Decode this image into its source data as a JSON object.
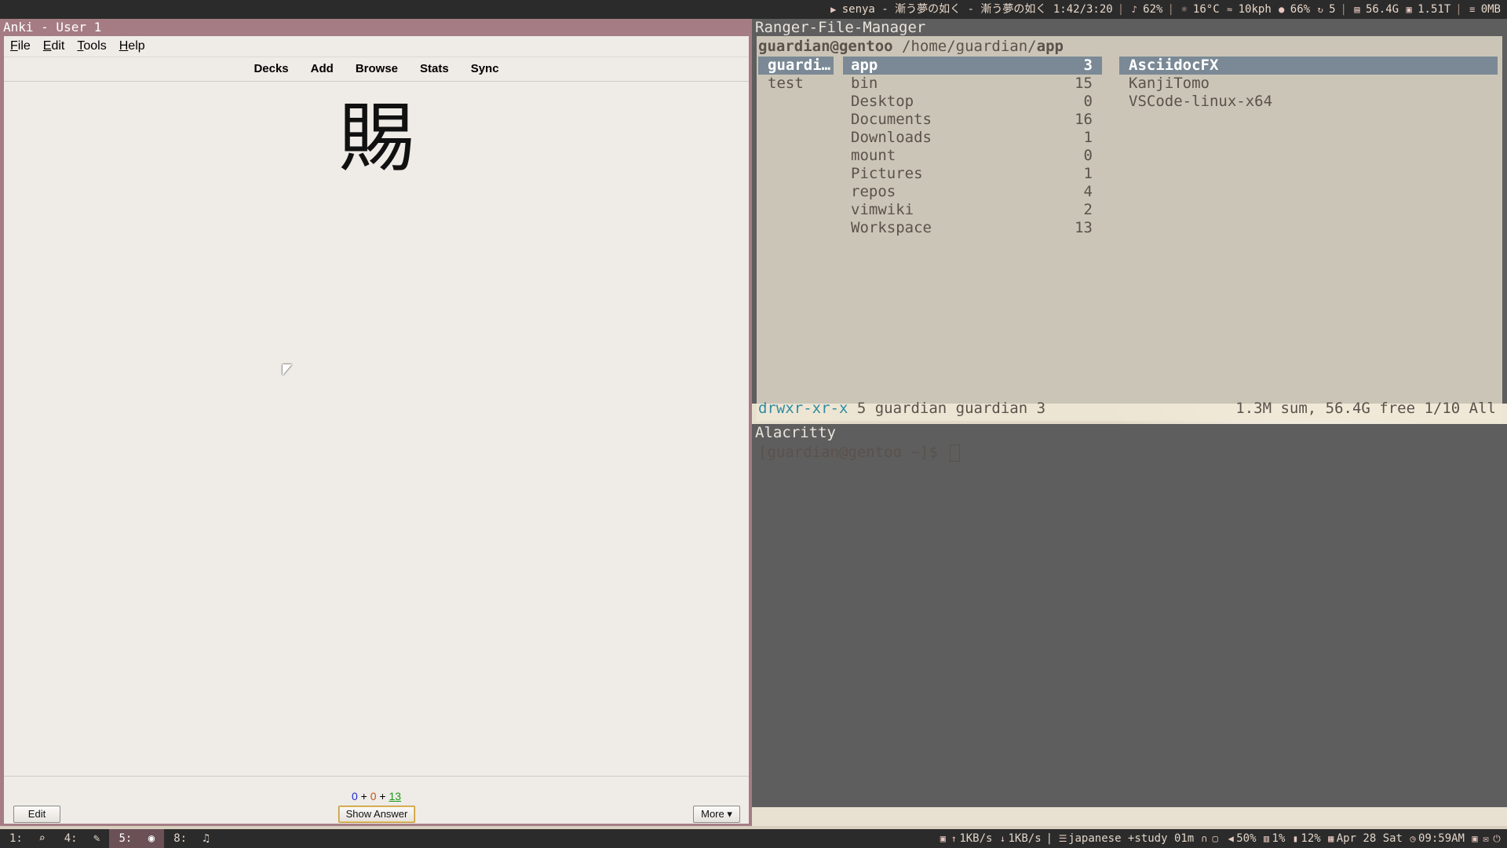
{
  "topbar": {
    "now_playing": "senya - 漸う夢の如く - 漸う夢の如く 1:42/3:20",
    "volume": "62%",
    "temp": "16°C",
    "wind": "10kph",
    "humidity": "66%",
    "updates": "5",
    "disk1": "56.4G",
    "disk2": "1.51T",
    "mem": "0MB"
  },
  "anki": {
    "window_title": "Anki - User 1",
    "menu": [
      "File",
      "Edit",
      "Tools",
      "Help"
    ],
    "toolbar": [
      "Decks",
      "Add",
      "Browse",
      "Stats",
      "Sync"
    ],
    "card_front": "賜",
    "counts": {
      "new": "0",
      "learn": "0",
      "review": "13",
      "plus": "+"
    },
    "buttons": {
      "edit": "Edit",
      "show_answer": "Show Answer",
      "more": "More ▾"
    }
  },
  "ranger": {
    "window_title": "Ranger-File-Manager",
    "user_host": "guardian@gentoo",
    "path_prefix": " /home/guardian/",
    "path_current": "app",
    "parent_column": [
      "guardi…",
      "test"
    ],
    "current_column": [
      {
        "name": "app",
        "count": "3"
      },
      {
        "name": "bin",
        "count": "15"
      },
      {
        "name": "Desktop",
        "count": "0"
      },
      {
        "name": "Documents",
        "count": "16"
      },
      {
        "name": "Downloads",
        "count": "1"
      },
      {
        "name": "mount",
        "count": "0"
      },
      {
        "name": "Pictures",
        "count": "1"
      },
      {
        "name": "repos",
        "count": "4"
      },
      {
        "name": "vimwiki",
        "count": "2"
      },
      {
        "name": "Workspace",
        "count": "13"
      }
    ],
    "preview_column": [
      "AsciidocFX",
      "KanjiTomo",
      "VSCode-linux-x64"
    ],
    "status": {
      "perms": "drwxr-xr-x",
      "info": " 5 guardian guardian 3",
      "right": "1.3M sum, 56.4G free  1/10  All"
    }
  },
  "alacritty": {
    "window_title": "Alacritty",
    "prompt": "[guardian@gentoo ~]$ "
  },
  "bottombar": {
    "workspaces": [
      "1:",
      "4:",
      "5:",
      "8:"
    ],
    "net_up": "1KB/s",
    "net_down": "1KB/s",
    "task": "japanese +study 01m",
    "vol": "50%",
    "cpu": "1%",
    "mem": "12%",
    "date": "Apr 28 Sat",
    "time": "09:59AM"
  }
}
